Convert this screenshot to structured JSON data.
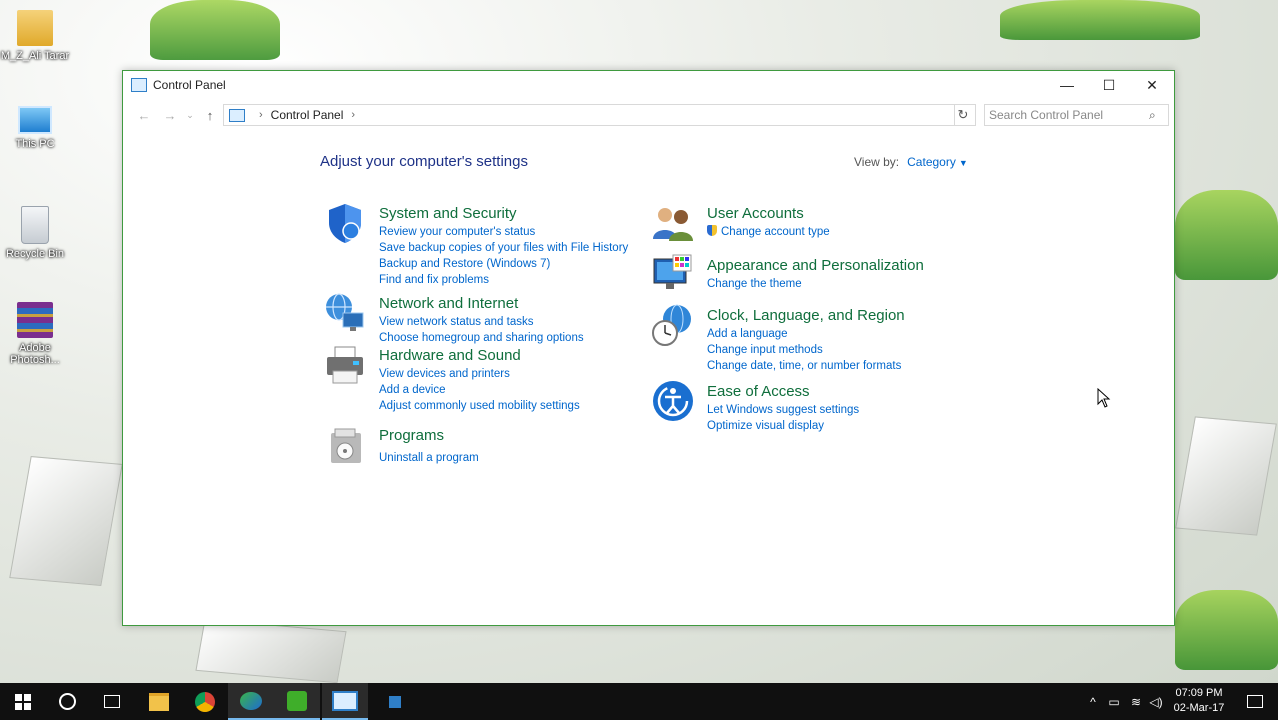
{
  "desktop": {
    "icons": [
      {
        "label": "M_Z_Ali Tarar"
      },
      {
        "label": "This PC"
      },
      {
        "label": "Recycle Bin"
      },
      {
        "label": "Adobe Photosh..."
      }
    ]
  },
  "window": {
    "title": "Control Panel",
    "controls": {
      "minimize": "—",
      "maximize": "☐",
      "close": "✕"
    },
    "address": {
      "root": "Control Panel"
    },
    "search": {
      "placeholder": "Search Control Panel"
    },
    "heading": "Adjust your computer's settings",
    "view_by": {
      "label": "View by:",
      "value": "Category"
    },
    "categories": [
      {
        "title": "System and Security",
        "icon": "shield-icon",
        "links": [
          "Review your computer's status",
          "Save backup copies of your files with File History",
          "Backup and Restore (Windows 7)",
          "Find and fix problems"
        ]
      },
      {
        "title": "Network and Internet",
        "icon": "network-globe-icon",
        "links": [
          "View network status and tasks",
          "Choose homegroup and sharing options"
        ]
      },
      {
        "title": "Hardware and Sound",
        "icon": "printer-icon",
        "links": [
          "View devices and printers",
          "Add a device",
          "Adjust commonly used mobility settings"
        ]
      },
      {
        "title": "Programs",
        "icon": "programs-icon",
        "links": [
          "Uninstall a program"
        ]
      },
      {
        "title": "User Accounts",
        "icon": "users-icon",
        "links": [
          "Change account type"
        ]
      },
      {
        "title": "Appearance and Personalization",
        "icon": "display-icon",
        "links": [
          "Change the theme"
        ]
      },
      {
        "title": "Clock, Language, and Region",
        "icon": "clock-globe-icon",
        "links": [
          "Add a language",
          "Change input methods",
          "Change date, time, or number formats"
        ]
      },
      {
        "title": "Ease of Access",
        "icon": "ease-of-access-icon",
        "links": [
          "Let Windows suggest settings",
          "Optimize visual display"
        ]
      }
    ]
  },
  "taskbar": {
    "clock_time": "07:09 PM",
    "clock_date": "02-Mar-17"
  },
  "colors": {
    "accent": "#0066cc",
    "category_title": "#0f6e3c",
    "heading": "#1e3287",
    "window_border": "#3f9a3f"
  }
}
